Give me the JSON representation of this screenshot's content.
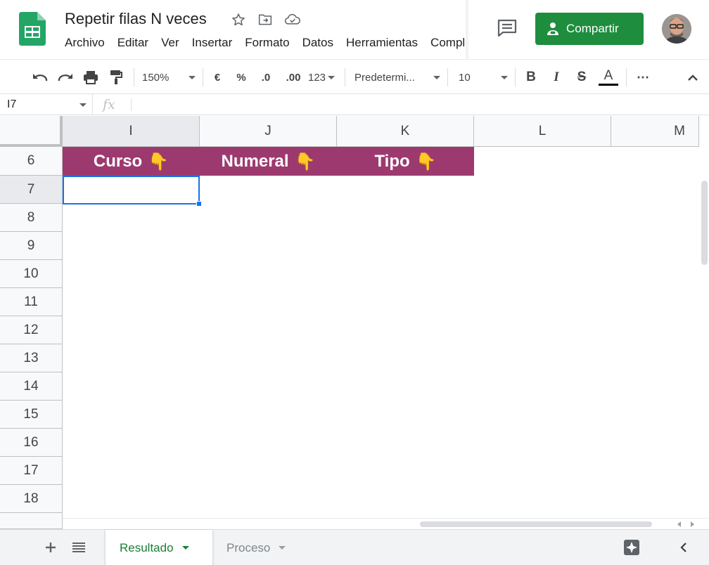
{
  "header": {
    "doc_title": "Repetir filas N veces",
    "menu": [
      "Archivo",
      "Editar",
      "Ver",
      "Insertar",
      "Formato",
      "Datos",
      "Herramientas",
      "Complementos"
    ],
    "share_label": "Compartir",
    "icons": [
      "sheets-logo-icon",
      "star-icon",
      "move-to-folder-icon",
      "cloud-saved-icon",
      "comment-icon",
      "share-person-icon",
      "user-avatar"
    ]
  },
  "toolbar": {
    "zoom": "150%",
    "currency": "€",
    "percent": "%",
    "decrease_decimals": ".0",
    "increase_decimals": ".00",
    "more_formats": "123",
    "font_name": "Predetermi...",
    "font_size": "10",
    "bold": "B",
    "italic": "I",
    "strikethrough": "S",
    "text_color": "A",
    "more": "⋯"
  },
  "formula_bar": {
    "cell_ref": "I7",
    "fx": "fx",
    "value": ""
  },
  "grid": {
    "columns": [
      "I",
      "J",
      "K",
      "L",
      "M"
    ],
    "selected_column": "I",
    "rows": [
      "6",
      "7",
      "8",
      "9",
      "10",
      "11",
      "12",
      "13",
      "14",
      "15",
      "16",
      "17",
      "18"
    ],
    "selected_row": "7",
    "header_fill": "#9c3a6f",
    "header_row": [
      {
        "text": "Curso",
        "emoji": "👇"
      },
      {
        "text": "Numeral",
        "emoji": "👇"
      },
      {
        "text": "Tipo",
        "emoji": "👇"
      }
    ],
    "selected_cell": "I7"
  },
  "sheet_tabs": {
    "active": "Resultado",
    "inactive": "Proceso"
  },
  "colors": {
    "share_green": "#1e8e3e",
    "active_tab_green": "#188038",
    "selection_blue": "#1a73e8"
  }
}
